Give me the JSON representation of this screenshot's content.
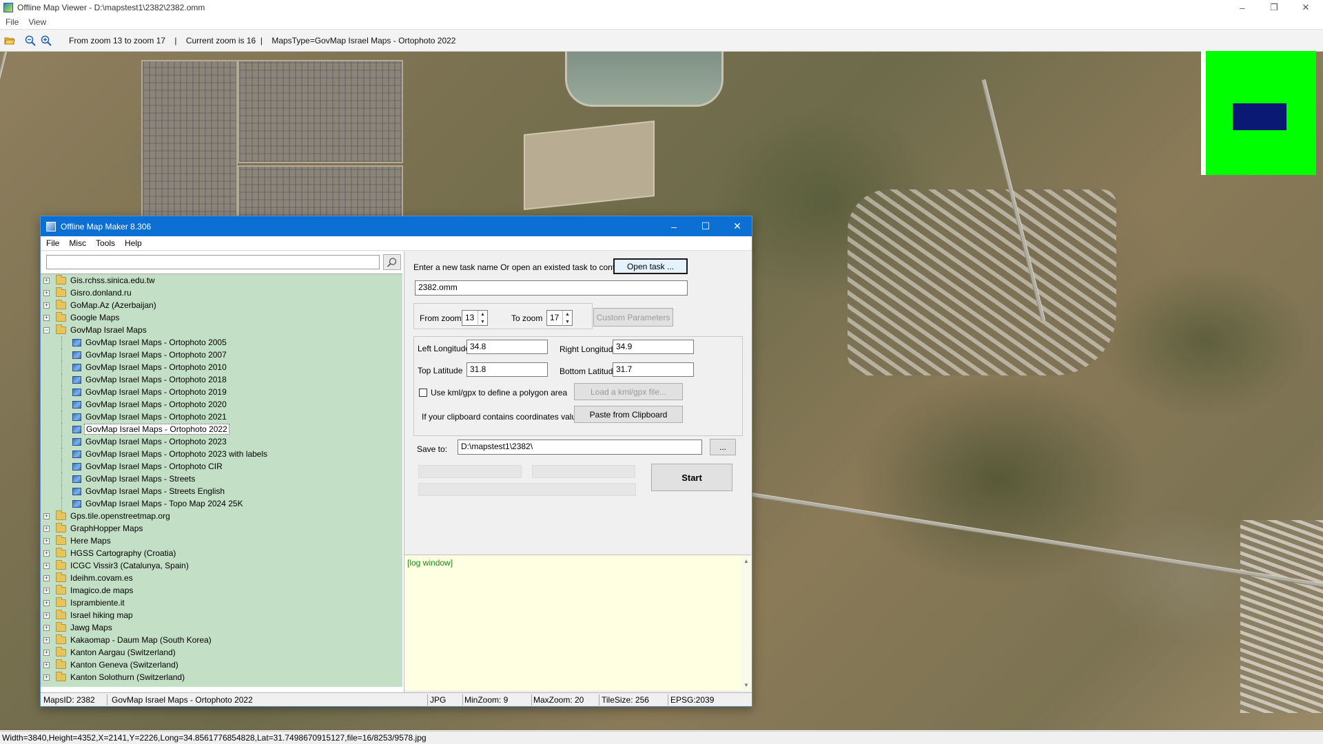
{
  "viewer": {
    "title": "Offline Map Viewer - D:\\mapstest1\\2382\\2382.omm",
    "menu": [
      "File",
      "View"
    ],
    "toolbar_info": "From zoom 13 to zoom 17    |    Current zoom is 16  |    MapsType=GovMap Israel Maps - Ortophoto 2022",
    "status": "Width=3840,Height=4352,X=2141,Y=2226,Long=34.8561776854828,Lat=31.7498670915127,file=16/8253/9578.jpg"
  },
  "maker": {
    "title": "Offline Map Maker 8.306",
    "menu": [
      "File",
      "Misc",
      "Tools",
      "Help"
    ],
    "search_value": "",
    "tree": [
      {
        "label": "Gis.rchss.sinica.edu.tw",
        "type": "folder",
        "expanded": false
      },
      {
        "label": "Gisro.donland.ru",
        "type": "folder",
        "expanded": false
      },
      {
        "label": "GoMap.Az (Azerbaijan)",
        "type": "folder",
        "expanded": false
      },
      {
        "label": "Google Maps",
        "type": "folder",
        "expanded": false
      },
      {
        "label": "GovMap Israel Maps",
        "type": "folder",
        "expanded": true
      },
      {
        "label": "GovMap Israel Maps - Ortophoto 2005",
        "type": "child"
      },
      {
        "label": "GovMap Israel Maps - Ortophoto 2007",
        "type": "child"
      },
      {
        "label": "GovMap Israel Maps - Ortophoto 2010",
        "type": "child"
      },
      {
        "label": "GovMap Israel Maps - Ortophoto 2018",
        "type": "child"
      },
      {
        "label": "GovMap Israel Maps - Ortophoto 2019",
        "type": "child"
      },
      {
        "label": "GovMap Israel Maps - Ortophoto 2020",
        "type": "child"
      },
      {
        "label": "GovMap Israel Maps - Ortophoto 2021",
        "type": "child"
      },
      {
        "label": "GovMap Israel Maps - Ortophoto 2022",
        "type": "child",
        "selected": true
      },
      {
        "label": "GovMap Israel Maps - Ortophoto 2023",
        "type": "child"
      },
      {
        "label": "GovMap Israel Maps - Ortophoto 2023 with labels",
        "type": "child"
      },
      {
        "label": "GovMap Israel Maps - Ortophoto CIR",
        "type": "child"
      },
      {
        "label": "GovMap Israel Maps - Streets",
        "type": "child"
      },
      {
        "label": "GovMap Israel Maps - Streets English",
        "type": "child"
      },
      {
        "label": "GovMap Israel Maps - Topo Map 2024 25K",
        "type": "child"
      },
      {
        "label": "Gps.tile.openstreetmap.org",
        "type": "folder",
        "expanded": false
      },
      {
        "label": "GraphHopper Maps",
        "type": "folder",
        "expanded": false
      },
      {
        "label": "Here Maps",
        "type": "folder",
        "expanded": false
      },
      {
        "label": "HGSS Cartography (Croatia)",
        "type": "folder",
        "expanded": false
      },
      {
        "label": "ICGC Vissir3 (Catalunya, Spain)",
        "type": "folder",
        "expanded": false
      },
      {
        "label": "Ideihm.covam.es",
        "type": "folder",
        "expanded": false
      },
      {
        "label": "Imagico.de maps",
        "type": "folder",
        "expanded": false
      },
      {
        "label": "Isprambiente.it",
        "type": "folder",
        "expanded": false
      },
      {
        "label": "Israel hiking map",
        "type": "folder",
        "expanded": false
      },
      {
        "label": "Jawg Maps",
        "type": "folder",
        "expanded": false
      },
      {
        "label": "Kakaomap - Daum Map (South Korea)",
        "type": "folder",
        "expanded": false
      },
      {
        "label": "Kanton Aargau (Switzerland)",
        "type": "folder",
        "expanded": false
      },
      {
        "label": "Kanton Geneva (Switzerland)",
        "type": "folder",
        "expanded": false
      },
      {
        "label": "Kanton Solothurn (Switzerland)",
        "type": "folder",
        "expanded": false
      }
    ],
    "task_prompt": "Enter a new task name Or open an existed task to continue:",
    "open_task_label": "Open task ...",
    "task_name": "2382.omm",
    "from_zoom_label": "From zoom",
    "from_zoom": "13",
    "to_zoom_label": "To zoom",
    "to_zoom": "17",
    "custom_params_label": "Custom Parameters",
    "left_lon_label": "Left Longitude",
    "left_lon": "34.8",
    "right_lon_label": "Right Longitude",
    "right_lon": "34.9",
    "top_lat_label": "Top Latitude",
    "top_lat": "31.8",
    "bottom_lat_label": "Bottom Latitude",
    "bottom_lat": "31.7",
    "kml_label": "Use kml/gpx to define a polygon area",
    "load_kml_label": "Load a kml/gpx file...",
    "clipboard_prompt": "If your clipboard contains coordinates values:",
    "paste_label": "Paste from Clipboard",
    "save_to_label": "Save to:",
    "save_to": "D:\\mapstest1\\2382\\",
    "browse_label": "...",
    "start_label": "Start",
    "log_text": "[log window]",
    "status": {
      "maps_id": "MapsID: 2382",
      "map_name": "GovMap Israel Maps - Ortophoto 2022",
      "format": "JPG",
      "min_zoom": "MinZoom: 9",
      "max_zoom": "MaxZoom: 20",
      "tile_size": "TileSize: 256",
      "epsg": "EPSG:2039"
    }
  },
  "colors": {
    "titlebar_blue": "#0c6fd4",
    "tree_bg": "#c3dfc5",
    "log_bg": "#ffffe1",
    "minimap_green": "#00ff00",
    "minimap_box": "#0a1a74"
  }
}
